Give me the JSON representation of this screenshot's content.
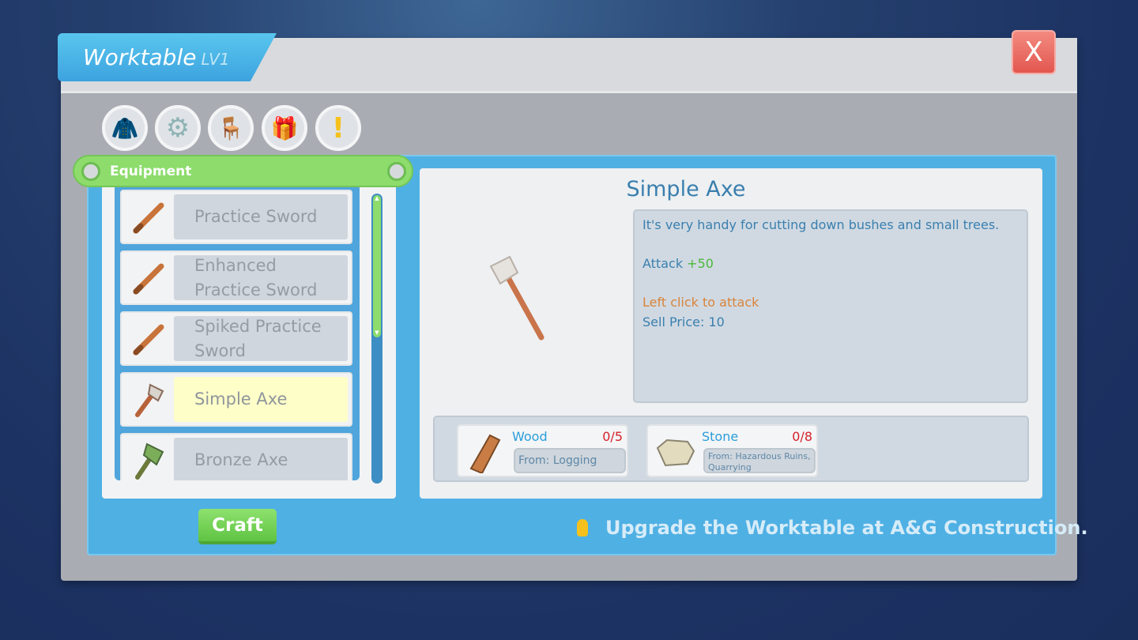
{
  "window": {
    "title": "Worktable",
    "level": "LV1",
    "close_label": "X"
  },
  "categories": [
    {
      "name": "clothing",
      "icon": "jacket-icon"
    },
    {
      "name": "parts",
      "icon": "gear-icon"
    },
    {
      "name": "furniture",
      "icon": "chair-icon"
    },
    {
      "name": "gifts",
      "icon": "gift-icon"
    },
    {
      "name": "special",
      "icon": "exclamation-icon"
    }
  ],
  "section": {
    "label": "Equipment"
  },
  "items": [
    {
      "name": "Practice Sword",
      "icon": "sword-icon"
    },
    {
      "name": "Enhanced Practice Sword",
      "icon": "sword-icon"
    },
    {
      "name": "Spiked Practice Sword",
      "icon": "sword-icon"
    },
    {
      "name": "Simple Axe",
      "icon": "axe-icon",
      "selected": true
    },
    {
      "name": "Bronze Axe",
      "icon": "bronze-axe-icon"
    }
  ],
  "detail": {
    "title": "Simple Axe",
    "description": "It's very handy for cutting down bushes and small trees.",
    "attack_label": "Attack",
    "attack_value": "+50",
    "action": "Left click to attack",
    "sell_price": "Sell Price: 10",
    "materials": [
      {
        "name": "Wood",
        "count": "0/5",
        "source": "From: Logging",
        "icon": "wood-log-icon"
      },
      {
        "name": "Stone",
        "count": "0/8",
        "source": "From: Hazardous Ruins, Quarrying",
        "icon": "stone-icon"
      }
    ]
  },
  "craft_label": "Craft",
  "hint": "Upgrade the Worktable at A&G Construction.",
  "colors": {
    "panel_blue": "#4fb0e4",
    "green": "#8ddc6c",
    "attack_green": "#4cb83a",
    "action_orange": "#d9843a",
    "count_red": "#d4222b"
  }
}
